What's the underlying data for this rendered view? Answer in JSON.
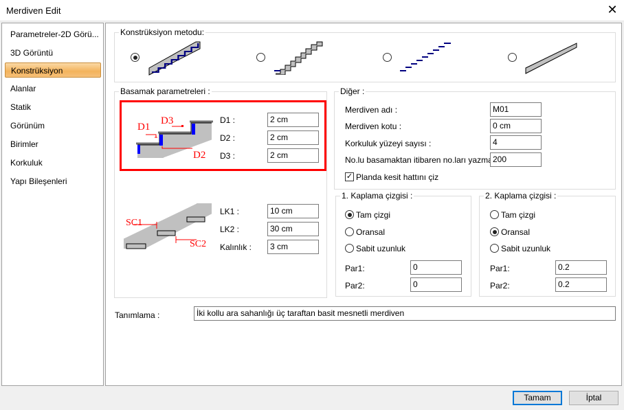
{
  "window": {
    "title": "Merdiven Edit",
    "close_icon": "close-icon"
  },
  "sidebar": {
    "items": [
      {
        "label": "Parametreler-2D Görü..."
      },
      {
        "label": "3D Görüntü"
      },
      {
        "label": "Konstrüksiyon",
        "active": true
      },
      {
        "label": "Alanlar"
      },
      {
        "label": "Statik"
      },
      {
        "label": "Görünüm"
      },
      {
        "label": "Birimler"
      },
      {
        "label": "Korkuluk"
      },
      {
        "label": "Yapı Bileşenleri"
      }
    ]
  },
  "construction": {
    "label": "Konstrüksiyon metodu:",
    "selected": 0,
    "options": [
      "stair-stepped-slab-icon",
      "stair-double-step-icon",
      "stair-floating-treads-icon",
      "stair-inclined-slab-icon"
    ]
  },
  "step_params": {
    "label": "Basamak parametreleri :",
    "diagram1": {
      "d1": "D1",
      "d2": "D2",
      "d3": "D3"
    },
    "diagram2": {
      "sc1": "SC1",
      "sc2": "SC2"
    },
    "fields": [
      {
        "label": "D1 :",
        "value": "2 cm"
      },
      {
        "label": "D2 :",
        "value": "2 cm"
      },
      {
        "label": "D3 :",
        "value": "2 cm"
      },
      {
        "label": "LK1 :",
        "value": "10 cm"
      },
      {
        "label": "LK2 :",
        "value": "30 cm"
      },
      {
        "label": "Kalınlık :",
        "value": "3 cm"
      }
    ],
    "highlight_color": "#ff0000"
  },
  "other": {
    "label": "Diğer :",
    "fields": [
      {
        "label": "Merdiven adı :",
        "value": "M01"
      },
      {
        "label": "Merdiven kotu :",
        "value": "0 cm"
      },
      {
        "label": "Korkuluk yüzeyi sayısı :",
        "value": "4"
      },
      {
        "label": "No.lu basamaktan itibaren no.ları yazma :",
        "value": "200"
      }
    ],
    "checkbox": {
      "label": "Planda kesit hattını çiz",
      "checked": true
    }
  },
  "cover1": {
    "label": "1. Kaplama çizgisi :",
    "options": [
      "Tam çizgi",
      "Oransal",
      "Sabit uzunluk"
    ],
    "selected": 0,
    "par1_label": "Par1:",
    "par1": "0",
    "par2_label": "Par2:",
    "par2": "0"
  },
  "cover2": {
    "label": "2. Kaplama çizgisi :",
    "options": [
      "Tam çizgi",
      "Oransal",
      "Sabit uzunluk"
    ],
    "selected": 1,
    "par1_label": "Par1:",
    "par1": "0.2",
    "par2_label": "Par2:",
    "par2": "0.2"
  },
  "description": {
    "label": "Tanımlama :",
    "value": "İki kollu ara sahanlığı üç taraftan basit mesnetli merdiven"
  },
  "buttons": {
    "ok": "Tamam",
    "cancel": "İptal"
  }
}
